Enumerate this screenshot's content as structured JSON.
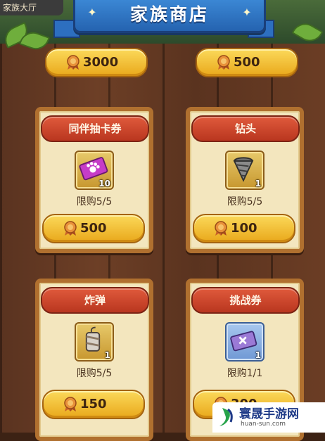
{
  "header": {
    "back_tab": "家族大厅",
    "title": "家族商店"
  },
  "shop": {
    "top_prices": [
      "3000",
      "500"
    ],
    "items": [
      {
        "name": "同伴抽卡券",
        "qty": "10",
        "limit": "限购5/5",
        "price": "500",
        "icon": "pet-card-ticket-icon"
      },
      {
        "name": "钻头",
        "qty": "1",
        "limit": "限购5/5",
        "price": "100",
        "icon": "drill-icon"
      },
      {
        "name": "炸弹",
        "qty": "1",
        "limit": "限购5/5",
        "price": "150",
        "icon": "bomb-icon"
      },
      {
        "name": "挑战券",
        "qty": "1",
        "limit": "限购1/1",
        "price": "300",
        "icon": "challenge-ticket-icon"
      }
    ]
  },
  "watermark": {
    "name": "寰晟手游网",
    "url": "huan-sun.com"
  },
  "colors": {
    "banner": "#2d6fc0",
    "card_title": "#c9432a",
    "price_button": "#f2c23a",
    "card_bg": "#f3e6be"
  }
}
